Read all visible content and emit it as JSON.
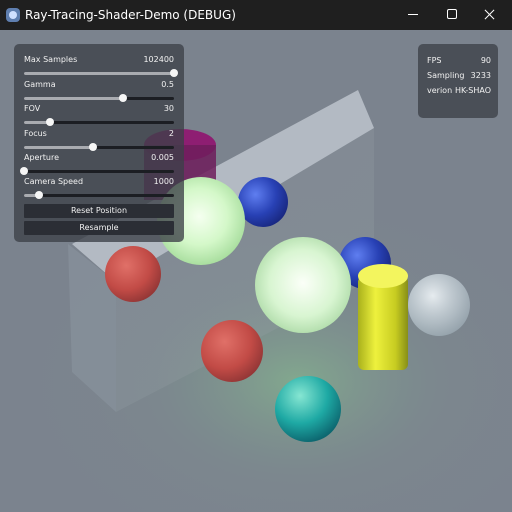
{
  "window": {
    "title": "Ray-Tracing-Shader-Demo (DEBUG)"
  },
  "icons": {
    "app": "render-app-icon",
    "minimize": "minimize-icon",
    "maximize": "maximize-icon",
    "close": "close-icon"
  },
  "settings": {
    "max_samples": {
      "label": "Max Samples",
      "value": "102400",
      "level": 1.0
    },
    "gamma": {
      "label": "Gamma",
      "value": "0.5",
      "level": 0.66
    },
    "fov": {
      "label": "FOV",
      "value": "30",
      "level": 0.17
    },
    "focus": {
      "label": "Focus",
      "value": "2",
      "level": 0.46
    },
    "aperture": {
      "label": "Aperture",
      "value": "0.005",
      "level": 0.0
    },
    "camera_speed": {
      "label": "Camera Speed",
      "value": "1000",
      "level": 0.1
    },
    "reset_label": "Reset Position",
    "resample_label": "Resample"
  },
  "stats": {
    "fps": {
      "label": "FPS",
      "value": "90"
    },
    "sampling": {
      "label": "Sampling",
      "value": "3233"
    },
    "version": {
      "label": "verion",
      "value": "HK-SHAO"
    }
  },
  "colors": {
    "titlebar": "#1f1f1f",
    "panel": "#3c4048",
    "slider_track": "#1c1e23",
    "slider_thumb": "#f6f6f6",
    "button": "#2b2e35",
    "scene_background": "#7b838e",
    "glow_sphere": "#d8ffd1",
    "red_sphere": "#c94f48",
    "blue_sphere": "#2740b8",
    "teal_sphere": "#1fa9a5",
    "yellow_cylinder": "#d2d620",
    "purple_cylinder": "#8e1e72",
    "glass_sphere": "#d8e4e9"
  }
}
